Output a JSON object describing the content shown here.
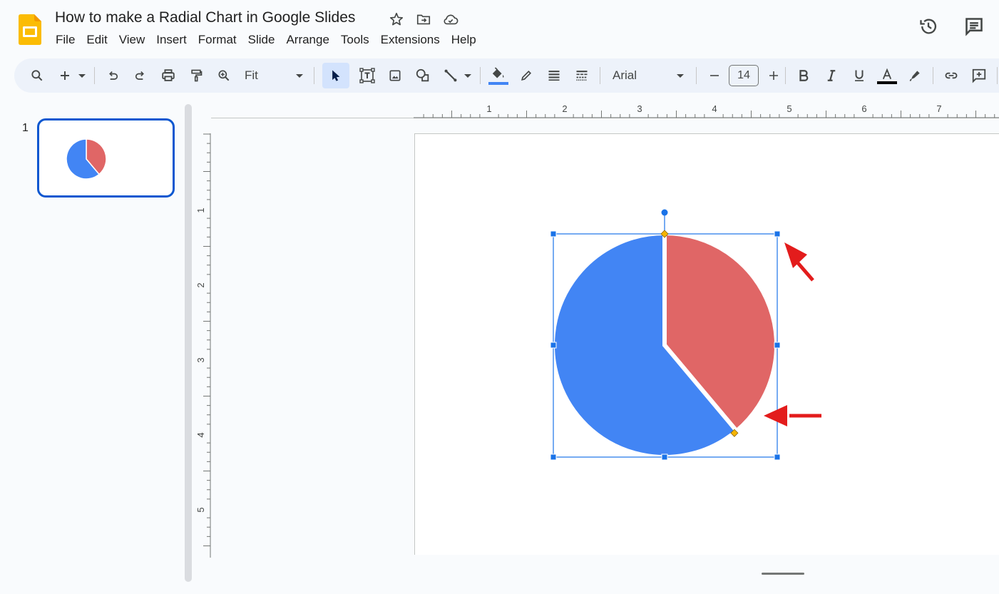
{
  "header": {
    "title": "How to make a Radial Chart in Google Slides",
    "title_icons": [
      "star-icon",
      "move-to-folder-icon",
      "cloud-saved-icon"
    ],
    "right_icons": [
      "version-history-icon",
      "comments-icon"
    ]
  },
  "menu": [
    "File",
    "Edit",
    "View",
    "Insert",
    "Format",
    "Slide",
    "Arrange",
    "Tools",
    "Extensions",
    "Help"
  ],
  "toolbar": {
    "zoom_value": "Fit",
    "font_family": "Arial",
    "font_size": "14",
    "fill_color": "#4285f4",
    "text_color": "#000000"
  },
  "filmstrip": {
    "slides": [
      {
        "number": "1"
      }
    ]
  },
  "rulers": {
    "horizontal_labels": [
      "1",
      "2",
      "3",
      "4",
      "5",
      "6",
      "7"
    ],
    "vertical_labels": [
      "1",
      "2",
      "3",
      "4",
      "5"
    ]
  },
  "slide": {
    "shape": "pie",
    "selected": true,
    "segments": [
      {
        "name": "red-slice",
        "color": "#e06666",
        "start_deg": 0,
        "end_deg": 140,
        "fraction": 0.39
      },
      {
        "name": "blue-slice",
        "color": "#4285f4",
        "start_deg": 140,
        "end_deg": 360,
        "fraction": 0.61
      }
    ],
    "annotations": [
      {
        "name": "arrow-to-corner-handle",
        "color": "#e31c1c"
      },
      {
        "name": "arrow-to-adjust-handle",
        "color": "#e31c1c"
      }
    ]
  },
  "colors": {
    "accent": "#0b57d0",
    "selection": "#1a73e8",
    "adjust_handle": "#f5b400"
  }
}
